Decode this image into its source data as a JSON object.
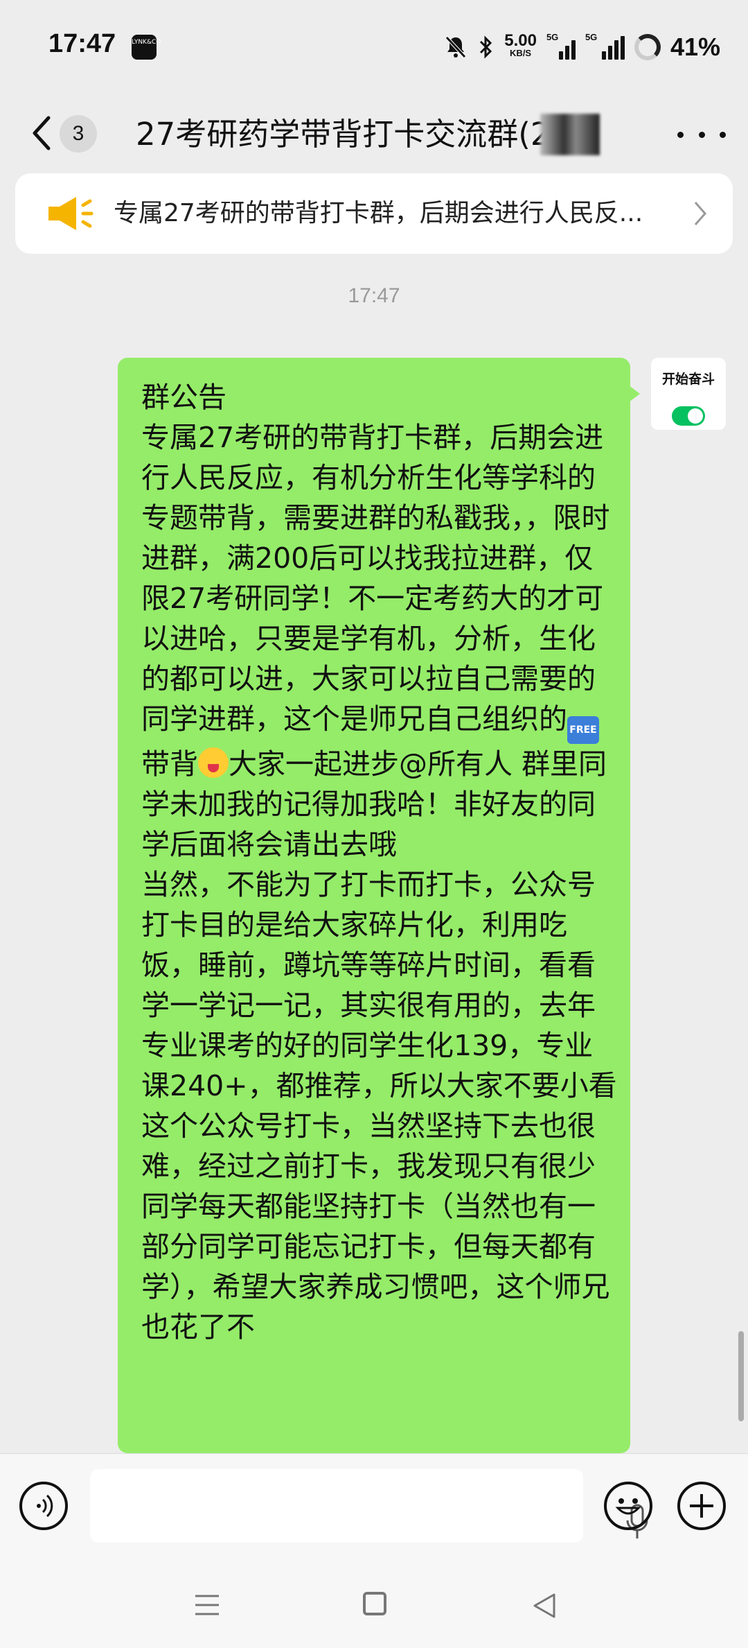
{
  "status_bar": {
    "time": "17:47",
    "app_badge": "LYNK&CO",
    "net_speed": "5.00",
    "net_speed_unit": "KB/S",
    "sim1_label": "5G",
    "sim2_label": "5G",
    "battery": "41%"
  },
  "header": {
    "unread_count": "3",
    "title": "27考研药学带背打卡交流群(2"
  },
  "notice": {
    "text": "专属27考研的带背打卡群，后期会进行人民反..."
  },
  "timestamp": "17:47",
  "message": {
    "part1": "群公告\n专属27考研的带背打卡群，后期会进行人民反应，有机分析生化等学科的专题带背，需要进群的私戳我，，限时进群，满200后可以找我拉进群，仅限27考研同学！不一定考药大的才可以进哈，只要是学有机，分析，生化的都可以进，大家可以拉自己需要的同学进群，这个是师兄自己组织的",
    "part2": "带背",
    "part3": "大家一起进步@所有人 群里同学未加我的记得加我哈！非好友的同学后面将会请出去哦\n当然，不能为了打卡而打卡，公众号打卡目的是给大家碎片化，利用吃饭，睡前，蹲坑等等碎片时间，看看学一学记一记，其实很有用的，去年专业课考的好的同学生化139，专业课240+，都推荐，所以大家不要小看这个公众号打卡，当然坚持下去也很难，经过之前打卡，我发现只有很少同学每天都能坚持打卡（当然也有一部分同学可能忘记打卡，但每天都有学），希望大家养成习惯吧，这个师兄也花了不",
    "free_emoji": "FREE"
  },
  "widget": {
    "label": "开始奋斗",
    "toggle_on": true
  },
  "colors": {
    "bubble": "#95ec69",
    "background": "#ededed",
    "toggle": "#07c160",
    "speaker": "#f5b400"
  }
}
